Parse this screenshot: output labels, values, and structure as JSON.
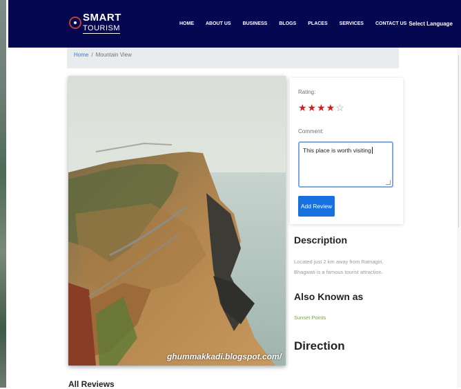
{
  "logo": {
    "top": "SMART",
    "bottom": "TOURISM"
  },
  "nav": {
    "items": [
      "HOME",
      "ABOUT US",
      "BUSINESS",
      "BLOGS",
      "PLACES",
      "SERVICES",
      "CONTACT US"
    ],
    "language": "Select Language"
  },
  "breadcrumb": {
    "home": "Home",
    "separator": "/",
    "current": "Mountain View"
  },
  "photo": {
    "watermark": "ghummakkadi.blogspot.com/"
  },
  "review": {
    "rating_label": "Rating:",
    "rating_value": 4,
    "rating_max": 5,
    "filled_stars": "★★★★",
    "empty_stars": "☆",
    "comment_label": "Comment:",
    "comment_value": "This place is worth visiting",
    "button_label": "Add Review"
  },
  "description": {
    "heading": "Description",
    "text": "Located just 2 km away from Ratnagiri, Bhagwati is a famous tourist attraction."
  },
  "also_known": {
    "heading": "Also Known as",
    "text": "Sunset Points"
  },
  "direction": {
    "heading": "Direction"
  },
  "reviews": {
    "heading": "All Reviews"
  },
  "colors": {
    "navbar": "#050850",
    "star": "#cc1f1f",
    "button": "#1670e0",
    "link": "#2f7cd4",
    "aka": "#7aa34a"
  }
}
